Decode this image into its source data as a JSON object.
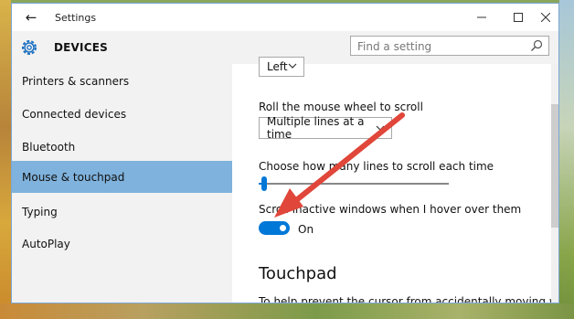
{
  "window": {
    "title": "Settings",
    "back_icon": "arrow-left-icon",
    "minimize_icon": "minimize-icon",
    "maximize_icon": "maximize-icon",
    "close_icon": "close-icon"
  },
  "header": {
    "section_icon": "gear-icon",
    "section_title": "DEVICES",
    "search_placeholder": "Find a setting"
  },
  "sidebar": {
    "items": [
      {
        "label": "Printers & scanners",
        "selected": false
      },
      {
        "label": "Connected devices",
        "selected": false
      },
      {
        "label": "Bluetooth",
        "selected": false
      },
      {
        "label": "Mouse & touchpad",
        "selected": true
      },
      {
        "label": "Typing",
        "selected": false
      },
      {
        "label": "AutoPlay",
        "selected": false
      }
    ]
  },
  "content": {
    "primary_button_value": "Left",
    "wheel_label": "Roll the mouse wheel to scroll",
    "wheel_value": "Multiple lines at a time",
    "lines_label": "Choose how many lines to scroll each time",
    "lines_slider_fraction": 0.03,
    "inactive_scroll_label": "Scroll inactive windows when I hover over them",
    "inactive_scroll_state": "On",
    "touchpad_heading": "Touchpad",
    "touchpad_desc": "To help prevent the cursor from accidentally moving while you"
  },
  "colors": {
    "accent": "#0078d7",
    "selected_nav": "#7fb2dc",
    "annotation_arrow": "#e0463a"
  }
}
